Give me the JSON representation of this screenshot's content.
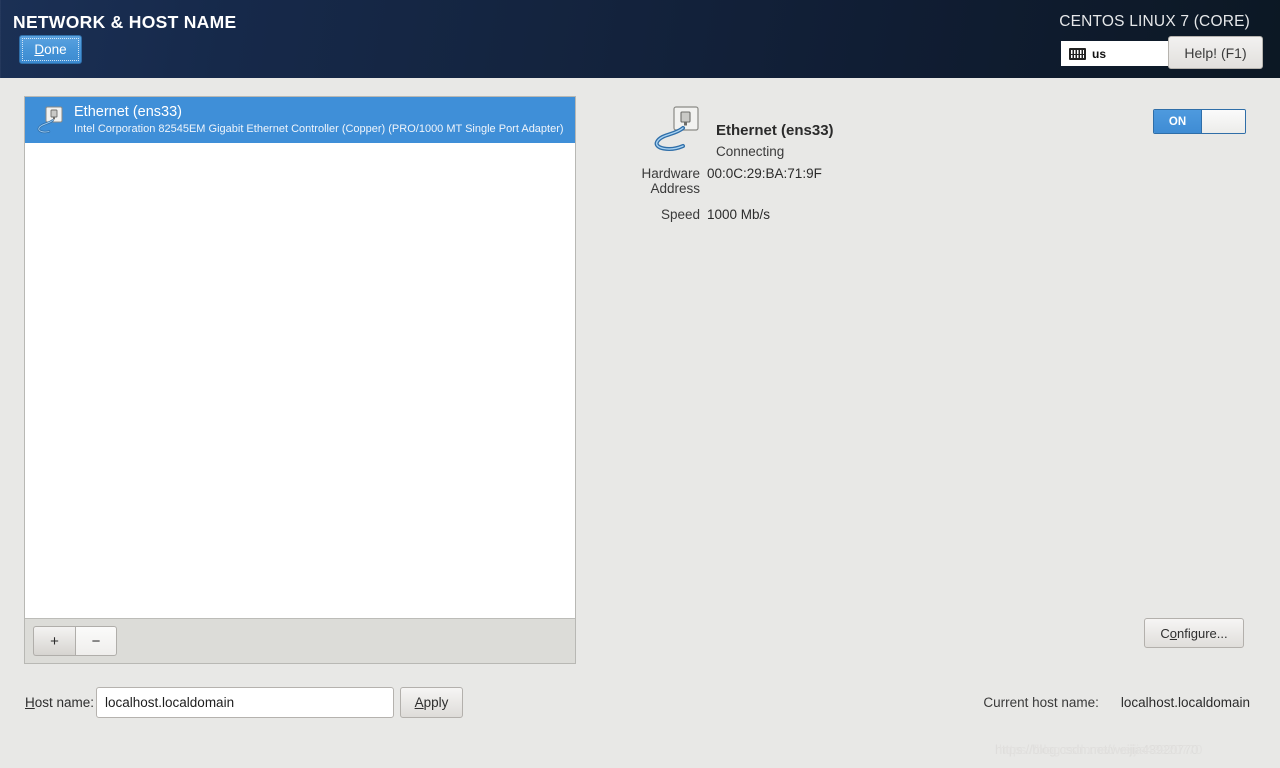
{
  "header": {
    "title": "NETWORK & HOST NAME",
    "done_label": "Done",
    "done_mnemonic": "D",
    "product_name": "CENTOS LINUX 7 (CORE)",
    "keyboard_layout": "us",
    "keyboard_icon": "keyboard-icon",
    "help_label": "Help! (F1)",
    "accent_color": "#4795d8",
    "background_color": "#14243f"
  },
  "device_list": {
    "devices": [
      {
        "name": "Ethernet (ens33)",
        "description": "Intel Corporation 82545EM Gigabit Ethernet Controller (Copper) (PRO/1000 MT Single Port Adapter)",
        "icon": "ethernet-icon",
        "selected": true
      }
    ],
    "add_label": "+",
    "remove_label": "−",
    "selection_color": "#3f8fd8"
  },
  "detail": {
    "icon": "ethernet-icon",
    "title": "Ethernet (ens33)",
    "status": "Connecting",
    "toggle": {
      "state_label": "ON",
      "on": true
    },
    "fields": [
      {
        "label": "Hardware Address",
        "value": "00:0C:29:BA:71:9F"
      },
      {
        "label": "Speed",
        "value": "1000 Mb/s"
      }
    ],
    "configure_label": "Configure...",
    "configure_mnemonic": "o"
  },
  "bottom": {
    "hostname_label": "Host name:",
    "hostname_mnemonic": "H",
    "hostname_value": "localhost.localdomain",
    "apply_label": "Apply",
    "apply_mnemonic": "A",
    "current_host_label": "Current host name:",
    "current_host_value": "localhost.localdomain"
  },
  "watermark": {
    "text": "https://blog.csdn.net/weijia43920770"
  }
}
